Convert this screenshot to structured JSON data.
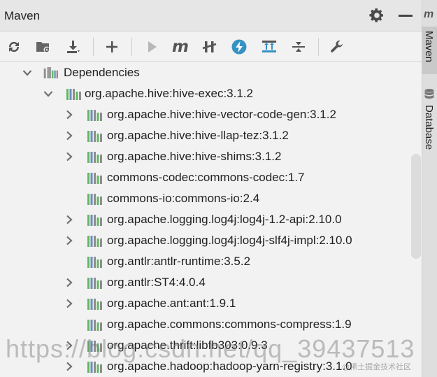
{
  "window": {
    "title": "Maven"
  },
  "toolbar": {
    "buttons": [
      "reload-all-projects",
      "generate-sources",
      "download-sources",
      "add-maven-project",
      "run-maven-build",
      "execute-maven-goal",
      "toggle-offline-mode",
      "skip-tests",
      "show-dependencies",
      "collapse-all",
      "maven-settings"
    ]
  },
  "colors": {
    "lib_bar_green": "#5fb85f",
    "lib_bar_blue": "#6c8ebf",
    "lib_bar_gray": "#8d8d8d",
    "accent_blue": "#3592c4"
  },
  "tree": {
    "dependencies_label": "Dependencies",
    "root": "org.apache.hive:hive-exec:3.1.2",
    "children": [
      "org.apache.hive:hive-vector-code-gen:3.1.2",
      "org.apache.hive:hive-llap-tez:3.1.2",
      "org.apache.hive:hive-shims:3.1.2",
      "commons-codec:commons-codec:1.7",
      "commons-io:commons-io:2.4",
      "org.apache.logging.log4j:log4j-1.2-api:2.10.0",
      "org.apache.logging.log4j:log4j-slf4j-impl:2.10.0",
      "org.antlr:antlr-runtime:3.5.2",
      "org.antlr:ST4:4.0.4",
      "org.apache.ant:ant:1.9.1",
      "org.apache.commons:commons-compress:1.9",
      "org.apache.thrift:libfb303:0.9.3",
      "org.apache.hadoop:hadoop-yarn-registry:3.1.0"
    ]
  },
  "side": {
    "m_logo": "m",
    "maven_tab": "Maven",
    "database_tab": "Database"
  },
  "watermark": {
    "main": "https://blog.csdn.net/qq_39437513",
    "sub": "@稀土掘金技术社区"
  }
}
